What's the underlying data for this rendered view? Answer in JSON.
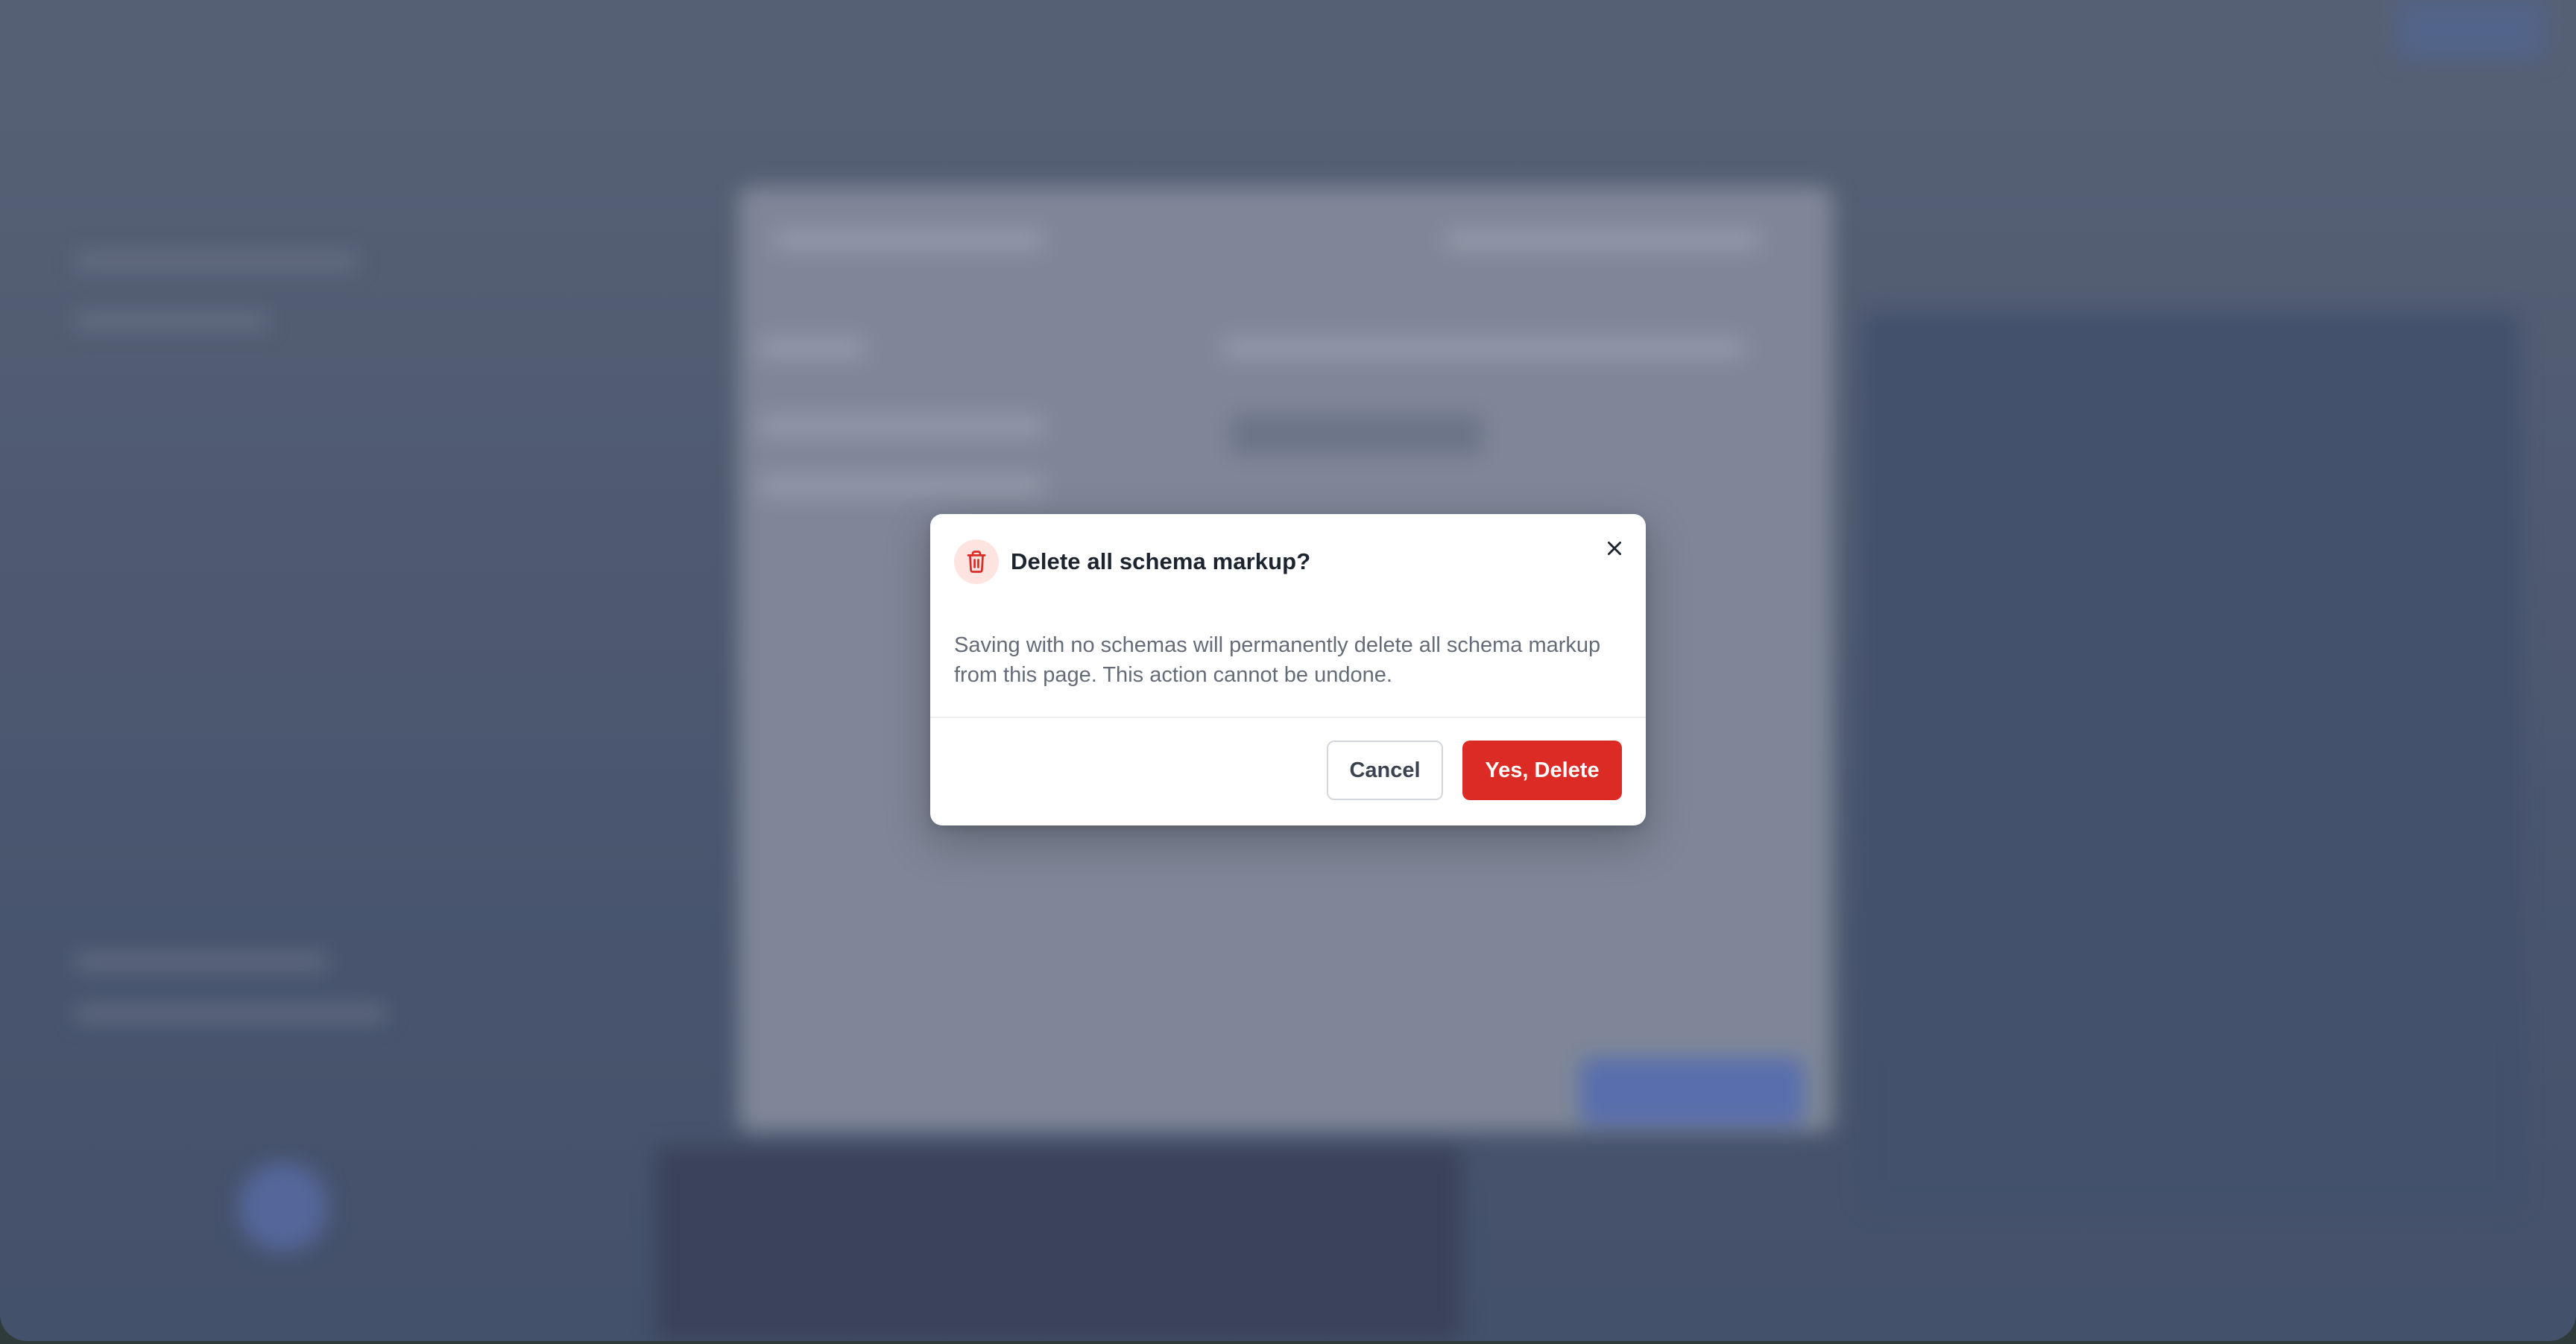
{
  "dialog": {
    "title": "Delete all schema markup?",
    "icon": "trash-icon",
    "close_icon": "close-icon",
    "message": "Saving with no schemas will permanently delete all schema markup from this page. This action cannot be undone.",
    "cancel_label": "Cancel",
    "confirm_label": "Yes, Delete"
  },
  "colors": {
    "danger": "#dc2b24",
    "danger_soft": "#fde4e1",
    "title_text": "#1c2430",
    "body_text": "#656c79"
  }
}
